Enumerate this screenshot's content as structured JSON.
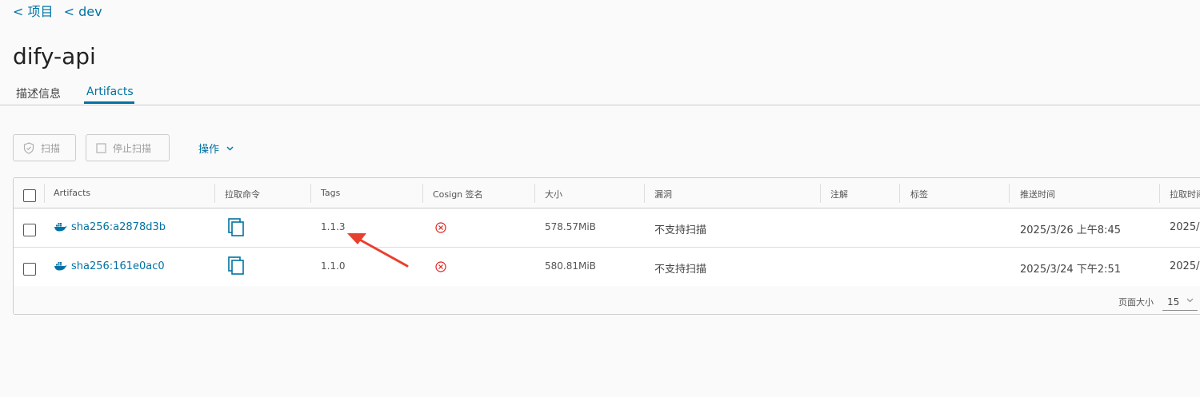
{
  "breadcrumb": {
    "projects": "< 项目",
    "dev": "< dev"
  },
  "title": "dify-api",
  "tabs": {
    "info": "描述信息",
    "artifacts": "Artifacts"
  },
  "toolbar": {
    "scan": "扫描",
    "stop_scan": "停止扫描",
    "actions": "操作"
  },
  "table": {
    "columns": [
      "Artifacts",
      "拉取命令",
      "Tags",
      "Cosign 签名",
      "大小",
      "漏洞",
      "注解",
      "标签",
      "推送时间",
      "拉取时间"
    ],
    "rows": [
      {
        "digest": "sha256:a2878d3b",
        "tag": "1.1.3",
        "size": "578.57MiB",
        "vuln": "不支持扫描",
        "push_time": "2025/3/26 上午8:45",
        "pull_time": "2025/"
      },
      {
        "digest": "sha256:161e0ac0",
        "tag": "1.1.0",
        "size": "580.81MiB",
        "vuln": "不支持扫描",
        "push_time": "2025/3/24 下午2:51",
        "pull_time": "2025/"
      }
    ]
  },
  "footer": {
    "page_size_label": "页面大小",
    "page_size": "15"
  },
  "colors": {
    "accent": "#0072a3",
    "error": "#e02020",
    "annotation_arrow": "#e8402e"
  }
}
